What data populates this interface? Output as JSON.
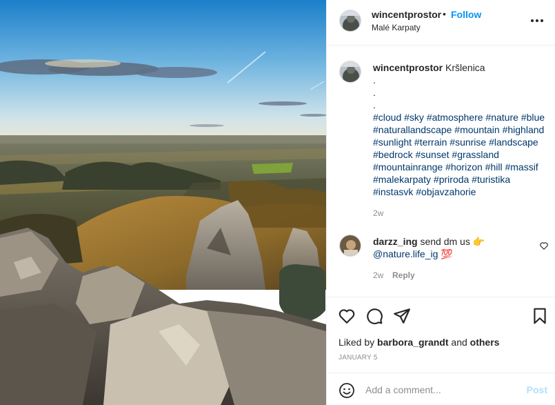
{
  "post": {
    "username": "wincentprostor",
    "separator": "•",
    "follow_label": "Follow",
    "location": "Malé Karpaty"
  },
  "caption": {
    "username": "wincentprostor",
    "text": "Kršlenica",
    "lines": [
      ".",
      ".",
      "."
    ],
    "hashtags": "#cloud #sky #atmosphere #nature #blue #naturallandscape #mountain #highland #sunlight #terrain #sunrise #landscape #bedrock #sunset #grassland #mountainrange #horizon #hill #massif #malekarpaty #priroda #turistika #instasvk #objavzahorie",
    "timestamp": "2w"
  },
  "comments": [
    {
      "username": "darzz_ing",
      "text": "send dm us",
      "emoji1": "👉",
      "mention": "@nature.life_ig",
      "emoji2": "💯",
      "timestamp": "2w",
      "reply_label": "Reply"
    }
  ],
  "likes": {
    "prefix": "Liked by",
    "user": "barbora_grandt",
    "middle": "and",
    "others": "others"
  },
  "date": "JANUARY 5",
  "add_comment": {
    "placeholder": "Add a comment...",
    "post_label": "Post"
  },
  "icons": {
    "more": "more-options-icon",
    "like": "heart-icon",
    "comment": "comment-icon",
    "share": "share-icon",
    "save": "bookmark-icon",
    "emoji": "emoji-icon"
  },
  "colors": {
    "link_blue": "#0095f6",
    "hashtag_blue": "#00376b",
    "muted": "#8e8e8e",
    "post_disabled": "#b2dffc"
  }
}
